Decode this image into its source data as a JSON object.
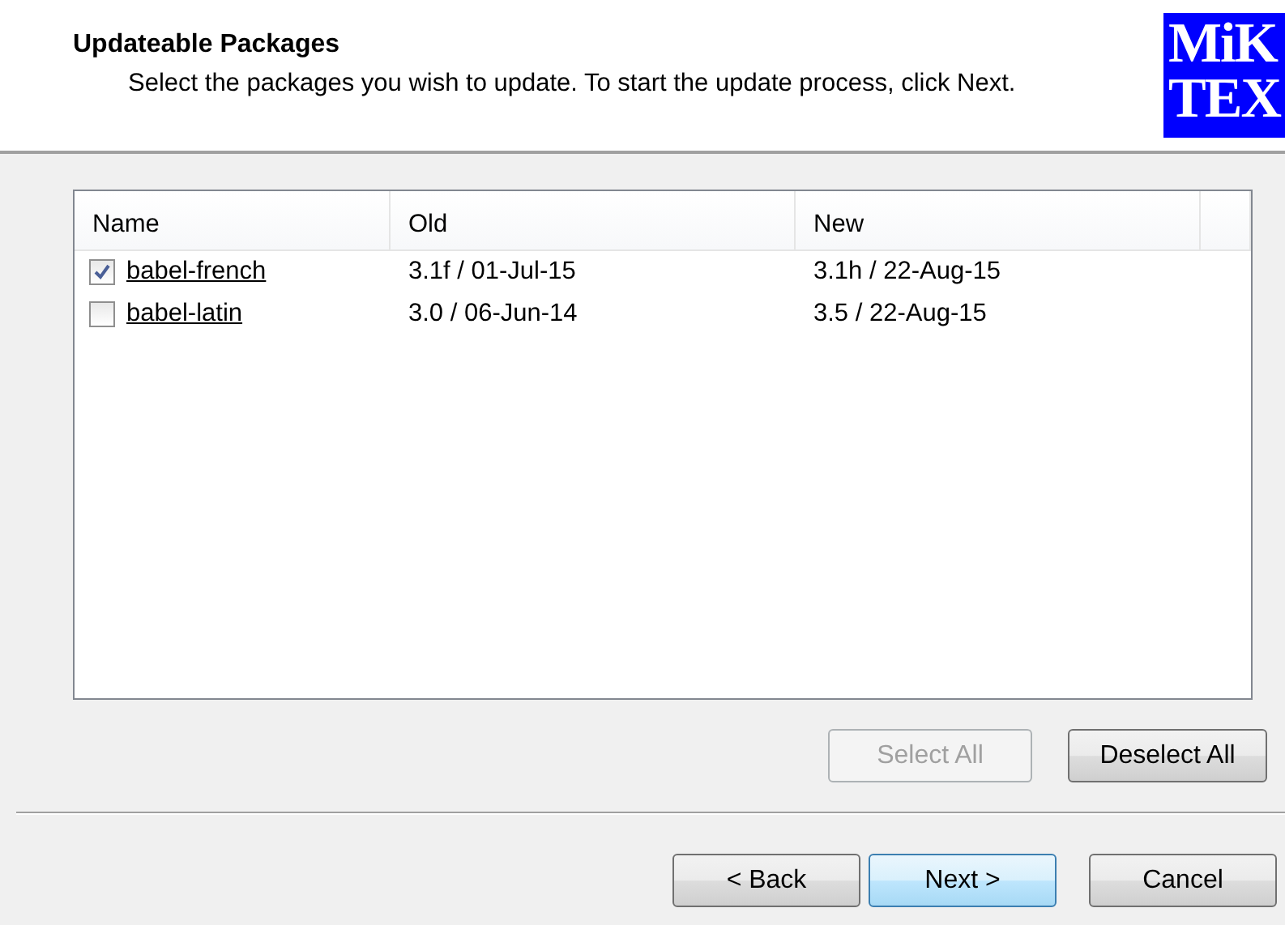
{
  "header": {
    "title": "Updateable Packages",
    "subtitle": "Select the packages you wish to update. To start the update process, click Next.",
    "logo_lines": [
      "MiK",
      "TEX"
    ]
  },
  "table": {
    "columns": [
      "Name",
      "Old",
      "New"
    ],
    "rows": [
      {
        "name": "babel-french",
        "old": "3.1f / 01-Jul-15",
        "new": "3.1h / 22-Aug-15",
        "checked": true
      },
      {
        "name": "babel-latin",
        "old": "3.0 / 06-Jun-14",
        "new": "3.5 / 22-Aug-15",
        "checked": false
      }
    ]
  },
  "list_buttons": [
    {
      "label": "Select All",
      "disabled": true
    },
    {
      "label": "Deselect All",
      "disabled": false
    }
  ],
  "nav_buttons": [
    {
      "label": "< Back",
      "default": false
    },
    {
      "label": "Next >",
      "default": true
    },
    {
      "label": "Cancel",
      "default": false
    }
  ]
}
